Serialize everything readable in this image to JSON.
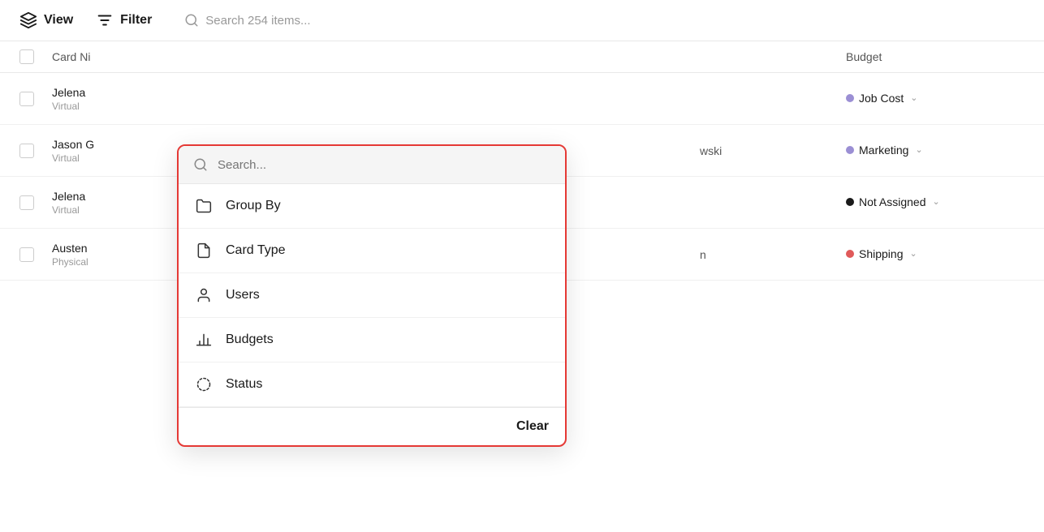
{
  "toolbar": {
    "view_label": "View",
    "filter_label": "Filter",
    "search_placeholder": "Search 254 items..."
  },
  "table": {
    "columns": [
      "Card Ni",
      "Budget"
    ],
    "rows": [
      {
        "name": "Jelena",
        "subname": "Virtual",
        "assignee": "",
        "budget_color": "#9b8fd4",
        "budget_label": "Job Cost",
        "show_chevron": true
      },
      {
        "name": "Jason G",
        "subname": "Virtual",
        "assignee": "wski",
        "budget_color": "#9b8fd4",
        "budget_label": "Marketing",
        "show_chevron": true
      },
      {
        "name": "Jelena",
        "subname": "Virtual",
        "assignee": "",
        "budget_color": "#1a1a1a",
        "budget_label": "Not Assigned",
        "show_chevron": true
      },
      {
        "name": "Austen",
        "subname": "Physical",
        "assignee": "n",
        "budget_color": "#e05a5a",
        "budget_label": "Shipping",
        "show_chevron": true
      }
    ]
  },
  "dropdown": {
    "search_placeholder": "Search...",
    "items": [
      {
        "id": "group-by",
        "label": "Group By",
        "icon": "folder"
      },
      {
        "id": "card-type",
        "label": "Card Type",
        "icon": "document"
      },
      {
        "id": "users",
        "label": "Users",
        "icon": "user"
      },
      {
        "id": "budgets",
        "label": "Budgets",
        "icon": "bar-chart"
      },
      {
        "id": "status",
        "label": "Status",
        "icon": "circle-dashed"
      }
    ],
    "clear_label": "Clear"
  }
}
